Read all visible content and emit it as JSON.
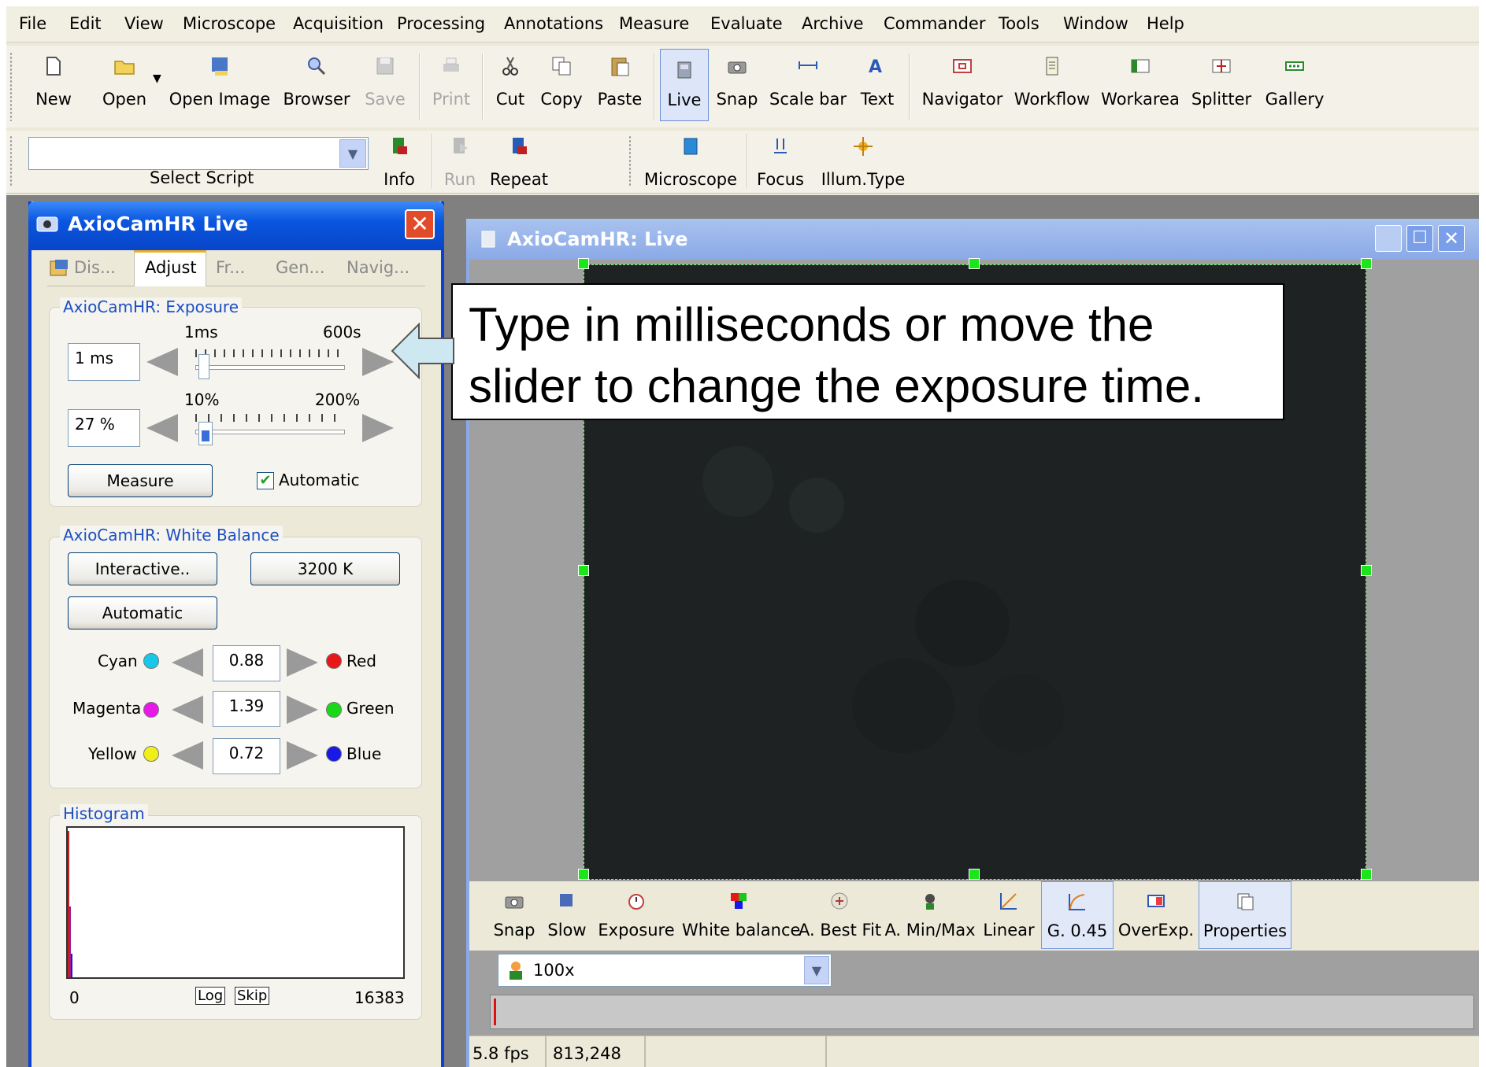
{
  "menubar": {
    "items": [
      "File",
      "Edit",
      "View",
      "Microscope",
      "Acquisition",
      "Processing",
      "Annotations",
      "Measure",
      "Evaluate",
      "Archive",
      "Commander",
      "Tools",
      "Window",
      "Help"
    ]
  },
  "toolbar": {
    "buttons": [
      "New",
      "Open",
      "Open Image",
      "Browser",
      "Save",
      "Print",
      "Cut",
      "Copy",
      "Paste",
      "Live",
      "Snap",
      "Scale bar",
      "Text",
      "Navigator",
      "Workflow",
      "Workarea",
      "Splitter",
      "Gallery"
    ]
  },
  "toolbar2": {
    "script_label": "Select Script",
    "script_value": "",
    "buttons": [
      "Info",
      "Run",
      "Repeat",
      "Microscope",
      "Focus",
      "Illum.Type"
    ]
  },
  "panel": {
    "title": "AxioCamHR Live",
    "tabs": [
      "Dis...",
      "Adjust",
      "Fr...",
      "Gen...",
      "Navig..."
    ],
    "exposure": {
      "title": "AxioCamHR: Exposure",
      "time_min": "1ms",
      "time_max": "600s",
      "time_value": "1 ms",
      "pct_min": "10%",
      "pct_max": "200%",
      "pct_value": "27 %",
      "measure_label": "Measure",
      "automatic_label": "Automatic"
    },
    "white_balance": {
      "title": "AxioCamHR: White Balance",
      "interactive_label": "Interactive..",
      "kelvin_label": "3200 K",
      "automatic_label": "Automatic",
      "rows": [
        {
          "left": "Cyan",
          "value": "0.88",
          "right": "Red"
        },
        {
          "left": "Magenta",
          "value": "1.39",
          "right": "Green"
        },
        {
          "left": "Yellow",
          "value": "0.72",
          "right": "Blue"
        }
      ]
    },
    "histogram": {
      "title": "Histogram",
      "min": "0",
      "max": "16383",
      "log_label": "Log",
      "skip_label": "Skip"
    }
  },
  "window": {
    "title": "AxioCamHR: Live",
    "callout": "Type in milliseconds or move the slider to change the exposure time.",
    "bottom_buttons": [
      "Snap",
      "Slow",
      "Exposure",
      "White balance",
      "A. Best Fit",
      "A. Min/Max",
      "Linear",
      "G. 0.45",
      "OverExp.",
      "Properties"
    ],
    "objective": "100x",
    "fps": "5.8 fps",
    "coords": "813,248"
  },
  "colors": {
    "accent": "#0a56e0",
    "dot_colors": {
      "Cyan": "#18c8e8",
      "Magenta": "#e818e8",
      "Yellow": "#f0f018",
      "Red": "#e81818",
      "Green": "#18d818",
      "Blue": "#1818e8"
    }
  }
}
